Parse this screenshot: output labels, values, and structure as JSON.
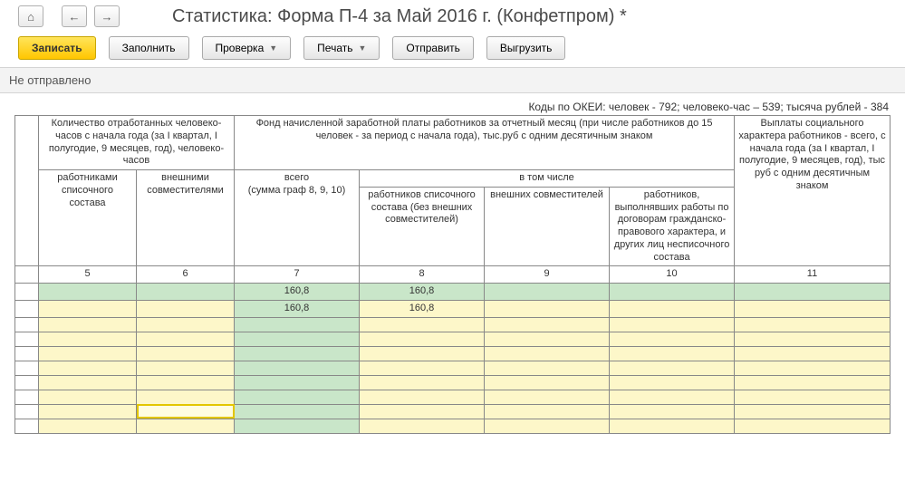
{
  "nav": {
    "home_icon": "⌂",
    "back_icon": "←",
    "forward_icon": "→"
  },
  "title": "Статистика: Форма П-4 за Май 2016 г. (Конфетпром) *",
  "toolbar": {
    "write": "Записать",
    "fill": "Заполнить",
    "check": "Проверка",
    "print": "Печать",
    "send": "Отправить",
    "export": "Выгрузить"
  },
  "status": "Не отправлено",
  "codes_line": "Коды по ОКЕИ: человек - 792; человеко-час – 539; тысяча рублей - 384",
  "headers": {
    "h5_6": "Количество отработанных человеко-часов с начала года (за I квартал, I полугодие, 9 месяцев, год), человеко-часов",
    "h7_10": "Фонд начисленной заработной платы работников за отчетный месяц (при числе работников до 15 человек - за период с начала года), тыс.руб с одним десятичным знаком",
    "h11": "Выплаты социального характера работников - всего, с начала года (за I квартал, I полугодие, 9 месяцев, год), тыс руб с одним десятичным знаком",
    "h5": "работниками списочного состава",
    "h6": "внешними совместителями",
    "h7": "всего\n(сумма граф 8, 9, 10)",
    "h8_10": "в том числе",
    "h8": "работников списочного состава (без внешних совместителей)",
    "h9": "внешних совместителей",
    "h10": "работников, выполнявших работы по договорам гражданско-правового характера, и других лиц несписочного состава",
    "colnums": [
      "5",
      "6",
      "7",
      "8",
      "9",
      "10",
      "11"
    ]
  },
  "data_rows": [
    {
      "cols": {
        "5": {
          "cls": "green"
        },
        "6": {
          "cls": "green"
        },
        "7": {
          "cls": "green",
          "v": "160,8"
        },
        "8": {
          "cls": "green",
          "v": "160,8"
        },
        "9": {
          "cls": "green"
        },
        "10": {
          "cls": "green"
        },
        "11": {
          "cls": "green"
        }
      }
    },
    {
      "cols": {
        "5": {
          "cls": "yellow"
        },
        "6": {
          "cls": "yellow"
        },
        "7": {
          "cls": "green",
          "v": "160,8"
        },
        "8": {
          "cls": "yellow",
          "v": "160,8"
        },
        "9": {
          "cls": "yellow"
        },
        "10": {
          "cls": "yellow"
        },
        "11": {
          "cls": "yellow"
        }
      }
    },
    {
      "cols": {
        "5": {
          "cls": "yellow"
        },
        "6": {
          "cls": "yellow"
        },
        "7": {
          "cls": "green"
        },
        "8": {
          "cls": "yellow"
        },
        "9": {
          "cls": "yellow"
        },
        "10": {
          "cls": "yellow"
        },
        "11": {
          "cls": "yellow"
        }
      }
    },
    {
      "cols": {
        "5": {
          "cls": "yellow"
        },
        "6": {
          "cls": "yellow"
        },
        "7": {
          "cls": "green"
        },
        "8": {
          "cls": "yellow"
        },
        "9": {
          "cls": "yellow"
        },
        "10": {
          "cls": "yellow"
        },
        "11": {
          "cls": "yellow"
        }
      }
    },
    {
      "cols": {
        "5": {
          "cls": "yellow"
        },
        "6": {
          "cls": "yellow"
        },
        "7": {
          "cls": "green"
        },
        "8": {
          "cls": "yellow"
        },
        "9": {
          "cls": "yellow"
        },
        "10": {
          "cls": "yellow"
        },
        "11": {
          "cls": "yellow"
        }
      }
    },
    {
      "cols": {
        "5": {
          "cls": "yellow"
        },
        "6": {
          "cls": "yellow"
        },
        "7": {
          "cls": "green"
        },
        "8": {
          "cls": "yellow"
        },
        "9": {
          "cls": "yellow"
        },
        "10": {
          "cls": "yellow"
        },
        "11": {
          "cls": "yellow"
        }
      }
    },
    {
      "cols": {
        "5": {
          "cls": "yellow"
        },
        "6": {
          "cls": "yellow"
        },
        "7": {
          "cls": "green"
        },
        "8": {
          "cls": "yellow"
        },
        "9": {
          "cls": "yellow"
        },
        "10": {
          "cls": "yellow"
        },
        "11": {
          "cls": "yellow"
        }
      }
    },
    {
      "cols": {
        "5": {
          "cls": "yellow"
        },
        "6": {
          "cls": "yellow"
        },
        "7": {
          "cls": "green"
        },
        "8": {
          "cls": "yellow"
        },
        "9": {
          "cls": "yellow"
        },
        "10": {
          "cls": "yellow"
        },
        "11": {
          "cls": "yellow"
        }
      }
    },
    {
      "cols": {
        "5": {
          "cls": "yellow"
        },
        "6": {
          "cls": "yellow",
          "active": true
        },
        "7": {
          "cls": "green"
        },
        "8": {
          "cls": "yellow"
        },
        "9": {
          "cls": "yellow"
        },
        "10": {
          "cls": "yellow"
        },
        "11": {
          "cls": "yellow"
        }
      }
    },
    {
      "cols": {
        "5": {
          "cls": "yellow"
        },
        "6": {
          "cls": "yellow"
        },
        "7": {
          "cls": "green"
        },
        "8": {
          "cls": "yellow"
        },
        "9": {
          "cls": "yellow"
        },
        "10": {
          "cls": "yellow"
        },
        "11": {
          "cls": "yellow"
        }
      }
    }
  ]
}
